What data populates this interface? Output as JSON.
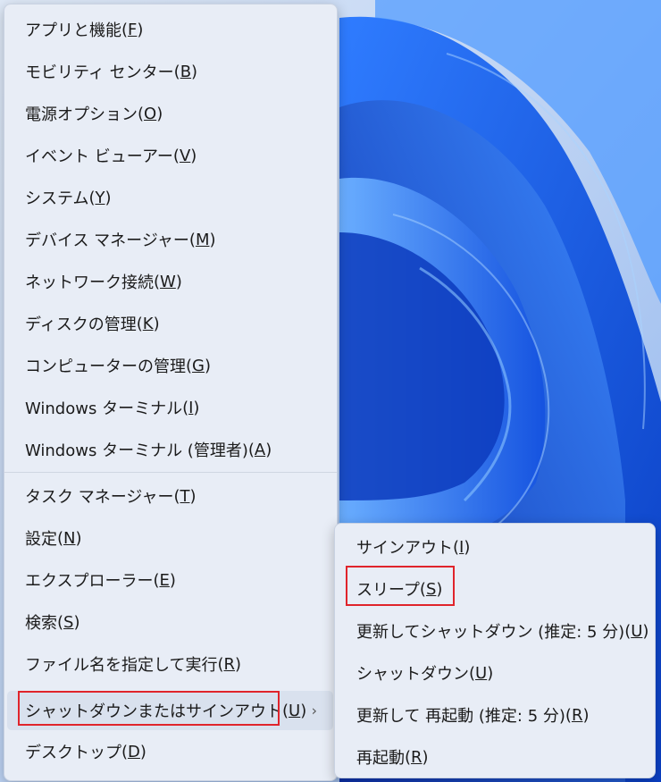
{
  "menu": {
    "items": [
      {
        "label": "アプリと機能",
        "key": "F"
      },
      {
        "label": "モビリティ センター",
        "key": "B"
      },
      {
        "label": "電源オプション",
        "key": "O"
      },
      {
        "label": "イベント ビューアー",
        "key": "V"
      },
      {
        "label": "システム",
        "key": "Y"
      },
      {
        "label": "デバイス マネージャー",
        "key": "M"
      },
      {
        "label": "ネットワーク接続",
        "key": "W"
      },
      {
        "label": "ディスクの管理",
        "key": "K"
      },
      {
        "label": "コンピューターの管理",
        "key": "G"
      },
      {
        "label": "Windows ターミナル",
        "key": "I"
      },
      {
        "label": "Windows ターミナル (管理者)",
        "key": "A"
      },
      {
        "label": "タスク マネージャー",
        "key": "T"
      },
      {
        "label": "設定",
        "key": "N"
      },
      {
        "label": "エクスプローラー",
        "key": "E"
      },
      {
        "label": "検索",
        "key": "S"
      },
      {
        "label": "ファイル名を指定して実行",
        "key": "R"
      },
      {
        "label": "シャットダウンまたはサインアウト",
        "key": "U"
      },
      {
        "label": "デスクトップ",
        "key": "D"
      }
    ],
    "chevron": "›"
  },
  "submenu": {
    "items": [
      {
        "label": "サインアウト",
        "key": "I"
      },
      {
        "label": "スリープ",
        "key": "S"
      },
      {
        "label": "更新してシャットダウン (推定: 5 分)",
        "key": "U"
      },
      {
        "label": "シャットダウン",
        "key": "U"
      },
      {
        "label": "更新して 再起動 (推定: 5 分)",
        "key": "R"
      },
      {
        "label": "再起動",
        "key": "R"
      }
    ]
  },
  "colors": {
    "menu_bg": "#e8edf6",
    "highlight": "#e0242b",
    "wallpaper_blue": "#1a55d8"
  }
}
